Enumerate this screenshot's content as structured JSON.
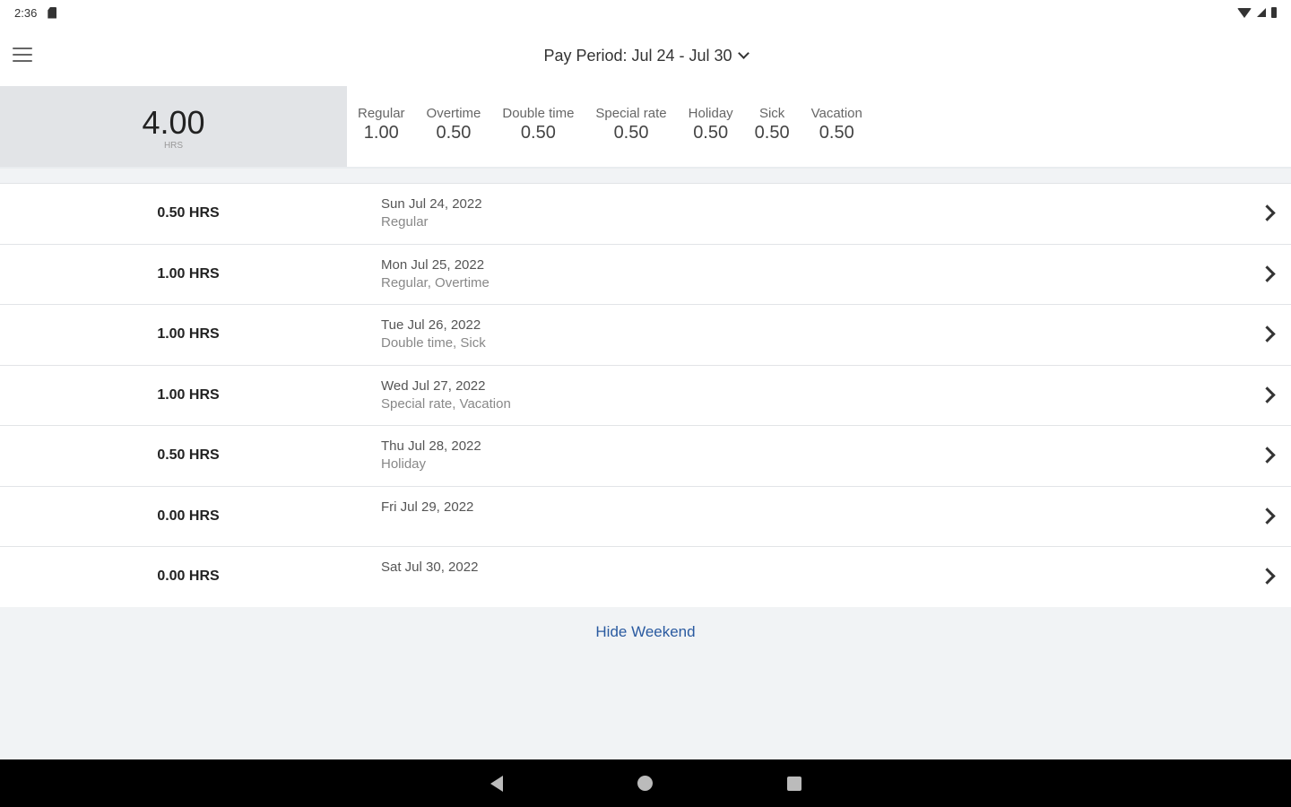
{
  "status_bar": {
    "time": "2:36"
  },
  "header": {
    "pay_period": "Pay Period: Jul 24 - Jul 30"
  },
  "summary": {
    "total": "4.00",
    "total_unit": "HRS",
    "breakdown": [
      {
        "label": "Regular",
        "value": "1.00"
      },
      {
        "label": "Overtime",
        "value": "0.50"
      },
      {
        "label": "Double time",
        "value": "0.50"
      },
      {
        "label": "Special rate",
        "value": "0.50"
      },
      {
        "label": "Holiday",
        "value": "0.50"
      },
      {
        "label": "Sick",
        "value": "0.50"
      },
      {
        "label": "Vacation",
        "value": "0.50"
      }
    ]
  },
  "days": [
    {
      "hours": "0.50 HRS",
      "date": "Sun Jul 24, 2022",
      "types": "Regular"
    },
    {
      "hours": "1.00 HRS",
      "date": "Mon Jul 25, 2022",
      "types": "Regular, Overtime"
    },
    {
      "hours": "1.00 HRS",
      "date": "Tue Jul 26, 2022",
      "types": "Double time, Sick"
    },
    {
      "hours": "1.00 HRS",
      "date": "Wed Jul 27, 2022",
      "types": "Special rate, Vacation"
    },
    {
      "hours": "0.50 HRS",
      "date": "Thu Jul 28, 2022",
      "types": "Holiday"
    },
    {
      "hours": "0.00 HRS",
      "date": "Fri Jul 29, 2022",
      "types": ""
    },
    {
      "hours": "0.00 HRS",
      "date": "Sat Jul 30, 2022",
      "types": ""
    }
  ],
  "footer": {
    "hide_weekend_label": "Hide Weekend"
  },
  "icons": {
    "menu": "menu-icon",
    "dropdown": "chevron-down-icon",
    "row_chevron": "chevron-right-icon",
    "nav_back": "nav-back-icon",
    "nav_home": "nav-home-icon",
    "nav_recents": "nav-recents-icon"
  },
  "colors": {
    "accent_link": "#2a5aa0",
    "total_box_bg": "#e2e4e7",
    "footer_bg": "#f1f3f5"
  }
}
